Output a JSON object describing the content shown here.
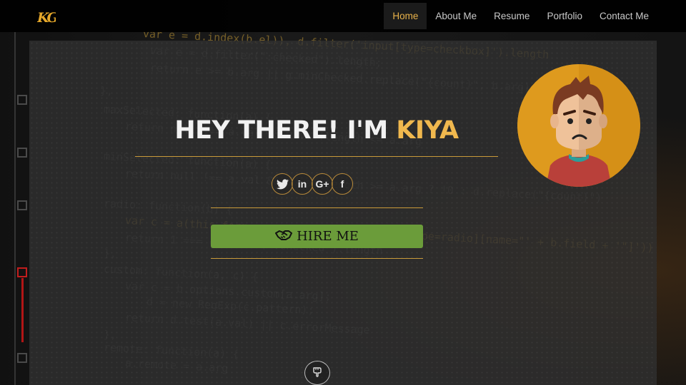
{
  "brand": {
    "logo_text": "KG"
  },
  "nav": {
    "items": [
      {
        "label": "Home",
        "active": true
      },
      {
        "label": "About Me",
        "active": false
      },
      {
        "label": "Resume",
        "active": false
      },
      {
        "label": "Portfolio",
        "active": false
      },
      {
        "label": "Contact Me",
        "active": false
      }
    ]
  },
  "hero": {
    "greeting": "HEY THERE! I'M ",
    "name": "KIYA",
    "hire_label": "HIRE ME",
    "hire_icon": "handshake-icon",
    "scroll_icon": "hand-pointing-down-icon"
  },
  "socials": [
    {
      "icon": "twitter-icon"
    },
    {
      "icon": "linkedin-icon",
      "glyph": "in"
    },
    {
      "icon": "google-plus-icon",
      "glyph": "G+"
    },
    {
      "icon": "facebook-icon",
      "glyph": "f"
    }
  ],
  "colors": {
    "accent": "#f0b84e",
    "nav_active": "#e8b24a",
    "hire_button": "#6b9c3a",
    "avatar_bg": "#de9a1e",
    "panel": "#303030"
  }
}
